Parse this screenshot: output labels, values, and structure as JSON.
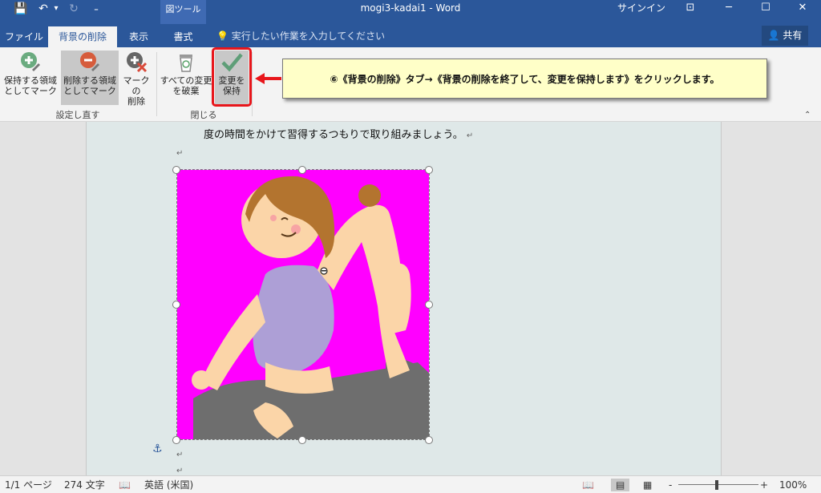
{
  "titlebar": {
    "title": "mogi3-kadai1 - Word",
    "context_label": "図ツール",
    "signin": "サインイン",
    "qat": {
      "save": "💾",
      "undo": "↶",
      "undo_menu": "▾",
      "redo": "↻",
      "customize": "₌"
    },
    "window": {
      "ribbon_display": "⊡",
      "minimize": "─",
      "maximize": "☐",
      "close": "✕"
    }
  },
  "tabs": [
    {
      "label": "ファイル"
    },
    {
      "label": "背景の削除"
    },
    {
      "label": "表示"
    },
    {
      "label": "書式"
    }
  ],
  "tellme": "実行したい作業を入力してください",
  "share": "共有",
  "ribbon": {
    "mark_keep": "保持する領域\nとしてマーク",
    "mark_keep_l1": "保持する領域",
    "mark_keep_l2": "としてマーク",
    "mark_remove_l1": "削除する領域",
    "mark_remove_l2": "としてマーク",
    "delete_mark_l1": "マークの",
    "delete_mark_l2": "削除",
    "discard_l1": "すべての変更",
    "discard_l2": "を破棄",
    "keep_l1": "変更を",
    "keep_l2": "保持",
    "group_refine": "設定し直す",
    "group_close": "閉じる"
  },
  "callout": "⑥《背景の削除》タブ→《背景の削除を終了して、変更を保持します》をクリックします。",
  "document": {
    "body_text": "度の時間をかけて習得するつもりで取り組みましょう。",
    "para_mark": "↵"
  },
  "status": {
    "page": "1/1 ページ",
    "words": "274 文字",
    "language": "英語 (米国)",
    "zoom": "100%",
    "zoom_minus": "-",
    "zoom_plus": "+"
  },
  "colors": {
    "accent": "#2b579a",
    "magenta": "#ff00ff",
    "highlight_red": "#e8161b",
    "callout_bg": "#ffffc8"
  }
}
